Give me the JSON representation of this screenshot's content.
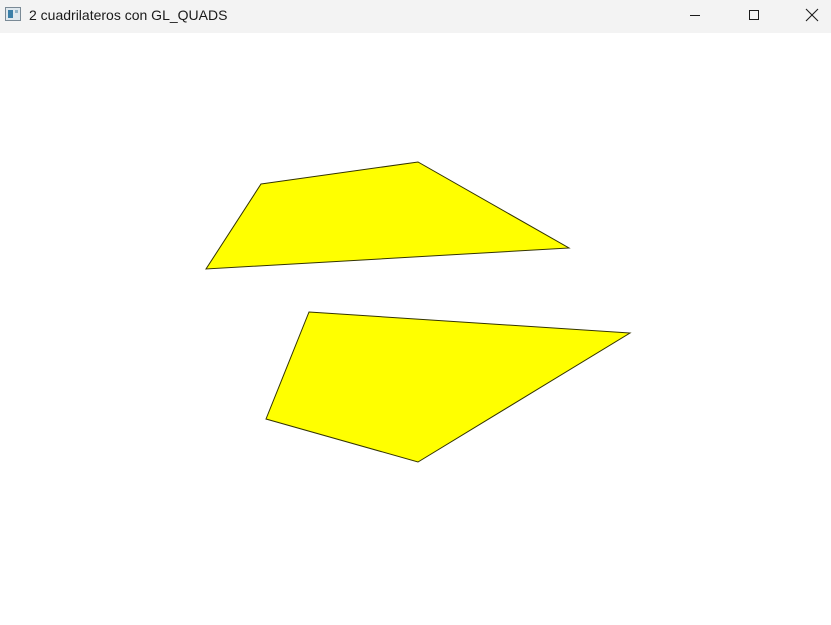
{
  "window": {
    "title": "2 cuadrilateros con GL_QUADS",
    "icon": "app-window-icon",
    "controls": {
      "minimize_icon": "minimize-icon",
      "maximize_icon": "maximize-icon",
      "close_icon": "close-icon"
    }
  },
  "scene": {
    "background": "#ffffff",
    "fill_color": "#ffff00",
    "stroke_color": "#333300",
    "quads": [
      {
        "name": "upper-quad"
      },
      {
        "name": "lower-quad"
      }
    ]
  }
}
